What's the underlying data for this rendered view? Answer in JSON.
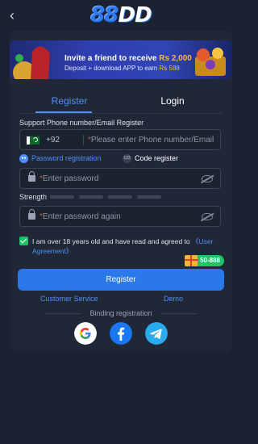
{
  "header": {
    "back_glyph": "‹",
    "logo_num": "88",
    "logo_txt": "DD"
  },
  "banner": {
    "line1_prefix": "Invite a friend to receive",
    "line1_amount": "Rs 2,000",
    "line2_prefix": "Deposit + download APP to earn",
    "line2_amount": "Rs 588"
  },
  "tabs": {
    "register": "Register",
    "login": "Login"
  },
  "form": {
    "phone_label": "Support Phone number/Email Register",
    "country_code": "+92",
    "phone_placeholder": "Please enter Phone number/Email",
    "mode_password": "Password registration",
    "mode_code": "Code register",
    "password_placeholder": "Enter password",
    "strength_label": "Strength",
    "confirm_placeholder": "Enter password again",
    "agree_text": "I am over 18 years old and have read and agreed to ",
    "agreement_link": "《User Agreement》",
    "bonus": "50-888",
    "register_button": "Register",
    "customer_service": "Customer Service",
    "demo": "Demo",
    "binding": "Binding registration"
  },
  "colors": {
    "accent": "#2b78e8",
    "check": "#21c168",
    "background": "#1b2333"
  },
  "icons": [
    "back-arrow-icon",
    "pakistan-flag-icon",
    "lock-icon",
    "eye-off-icon",
    "gift-icon",
    "google-icon",
    "facebook-icon",
    "telegram-icon"
  ]
}
